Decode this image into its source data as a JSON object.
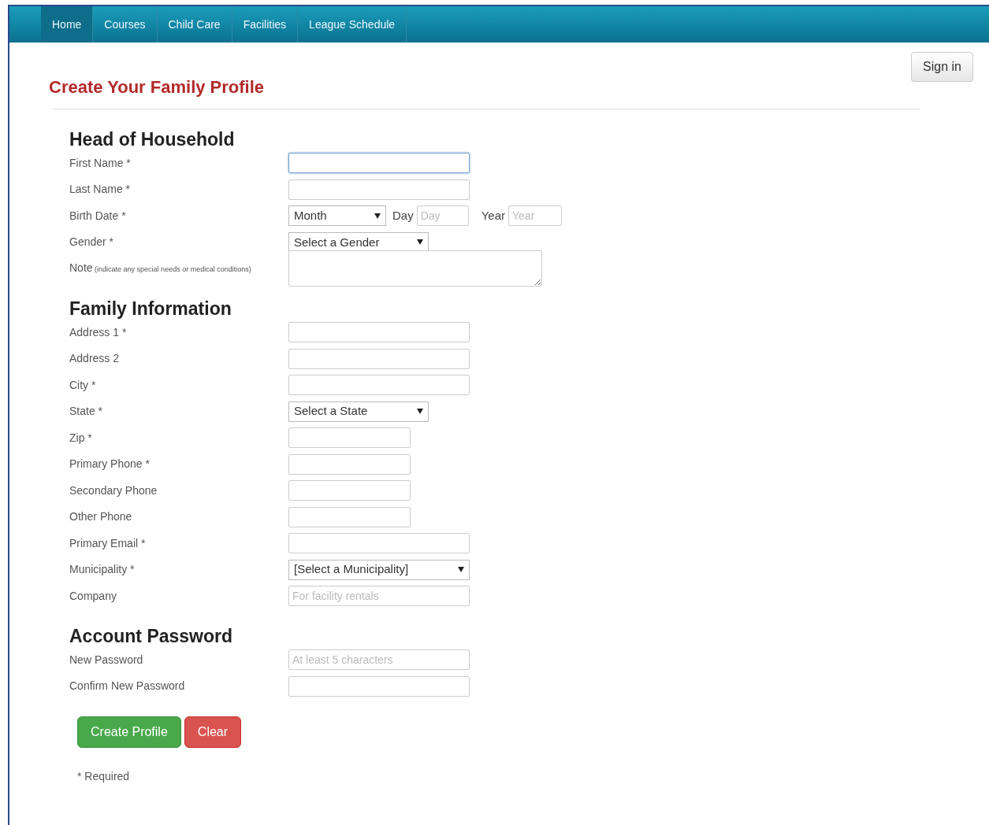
{
  "nav": [
    {
      "label": "Home",
      "selected": true
    },
    {
      "label": "Courses",
      "selected": false
    },
    {
      "label": "Child Care",
      "selected": false
    },
    {
      "label": "Facilities",
      "selected": false
    },
    {
      "label": "League Schedule",
      "selected": false
    }
  ],
  "sign_in": "Sign in",
  "title": "Create Your Family Profile",
  "sections": [
    {
      "heading": "Head of Household",
      "fields": [
        {
          "kind": "text",
          "label": "First Name *",
          "focused": true
        },
        {
          "kind": "text",
          "label": "Last Name *",
          "focused": false
        },
        {
          "kind": "date",
          "label": "Birth Date *",
          "month": "Month",
          "day_label": "Day",
          "day_placeholder": "Day",
          "year_label": "Year",
          "year_placeholder": "Year"
        },
        {
          "kind": "select",
          "label": "Gender *",
          "value": "Select a Gender"
        },
        {
          "kind": "textarea",
          "label": "Note",
          "hint": "(indicate any special needs or medical conditions)",
          "focused": false
        }
      ]
    },
    {
      "heading": "Family Information",
      "fields": [
        {
          "kind": "text",
          "label": "Address 1 *",
          "focused": false
        },
        {
          "kind": "text",
          "label": "Address 2",
          "focused": false
        },
        {
          "kind": "text",
          "label": "City *",
          "focused": false
        },
        {
          "kind": "select",
          "label": "State *",
          "value": "Select a State"
        },
        {
          "kind": "short-text",
          "label": "Zip *",
          "focused": false
        },
        {
          "kind": "short-text",
          "label": "Primary Phone *",
          "focused": false
        },
        {
          "kind": "short-text",
          "label": "Secondary Phone",
          "focused": false
        },
        {
          "kind": "short-text",
          "label": "Other Phone",
          "focused": false
        },
        {
          "kind": "text",
          "label": "Primary Email *",
          "focused": false
        },
        {
          "kind": "wide-select",
          "label": "Municipality *",
          "value": "[Select a Municipality]"
        },
        {
          "kind": "text",
          "label": "Company",
          "placeholder": "For facility rentals",
          "focused": false
        }
      ]
    },
    {
      "heading": "Account Password",
      "fields": [
        {
          "kind": "text",
          "label": "New Password",
          "placeholder": "At least 5 characters",
          "focused": false
        },
        {
          "kind": "text",
          "label": "Confirm New Password",
          "focused": false
        }
      ]
    }
  ],
  "buttons": [
    {
      "kind": "success",
      "label": "Create Profile"
    },
    {
      "kind": "danger",
      "label": "Clear"
    }
  ],
  "footnote": "* Required"
}
